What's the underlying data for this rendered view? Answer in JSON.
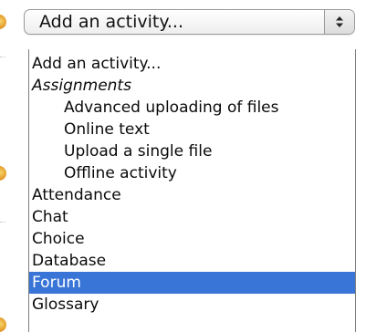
{
  "select": {
    "value": "Add an activity...",
    "stepper_icon": "up-down-arrows-icon"
  },
  "menu": {
    "first": "Add an activity...",
    "group_label": "Assignments",
    "group_items": [
      "Advanced uploading of files",
      "Online text",
      "Upload a single file",
      "Offline activity"
    ],
    "items": [
      "Attendance",
      "Chat",
      "Choice",
      "Database",
      "Forum",
      "Glossary"
    ],
    "selected": "Forum"
  },
  "colors": {
    "selection": "#3875d7",
    "icon": "#e39a27"
  }
}
